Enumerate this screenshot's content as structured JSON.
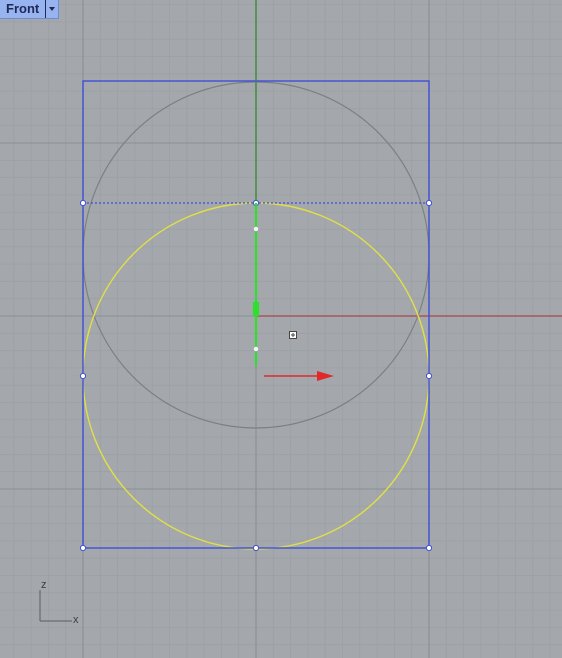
{
  "viewport": {
    "name": "Front",
    "axes": {
      "vertical": "z",
      "horizontal": "x"
    }
  },
  "colors": {
    "background": "#a4a8ad",
    "grid_minor": "#9aa0a5",
    "grid_major": "#8a8f95",
    "world_x_axis": "#a34848",
    "world_z_axis": "#2e8a2e",
    "bounding_box": "#3f4fd8",
    "ghost_circle": "#7d7f82",
    "selected_circle": "#e0e044",
    "gumball_green": "#2ce02c",
    "gumball_red": "#e02a2a",
    "tab_bg": "#97b3f0"
  },
  "icons": [
    "dropdown-arrow-icon",
    "move-cursor-icon",
    "axis-indicator-icon"
  ]
}
